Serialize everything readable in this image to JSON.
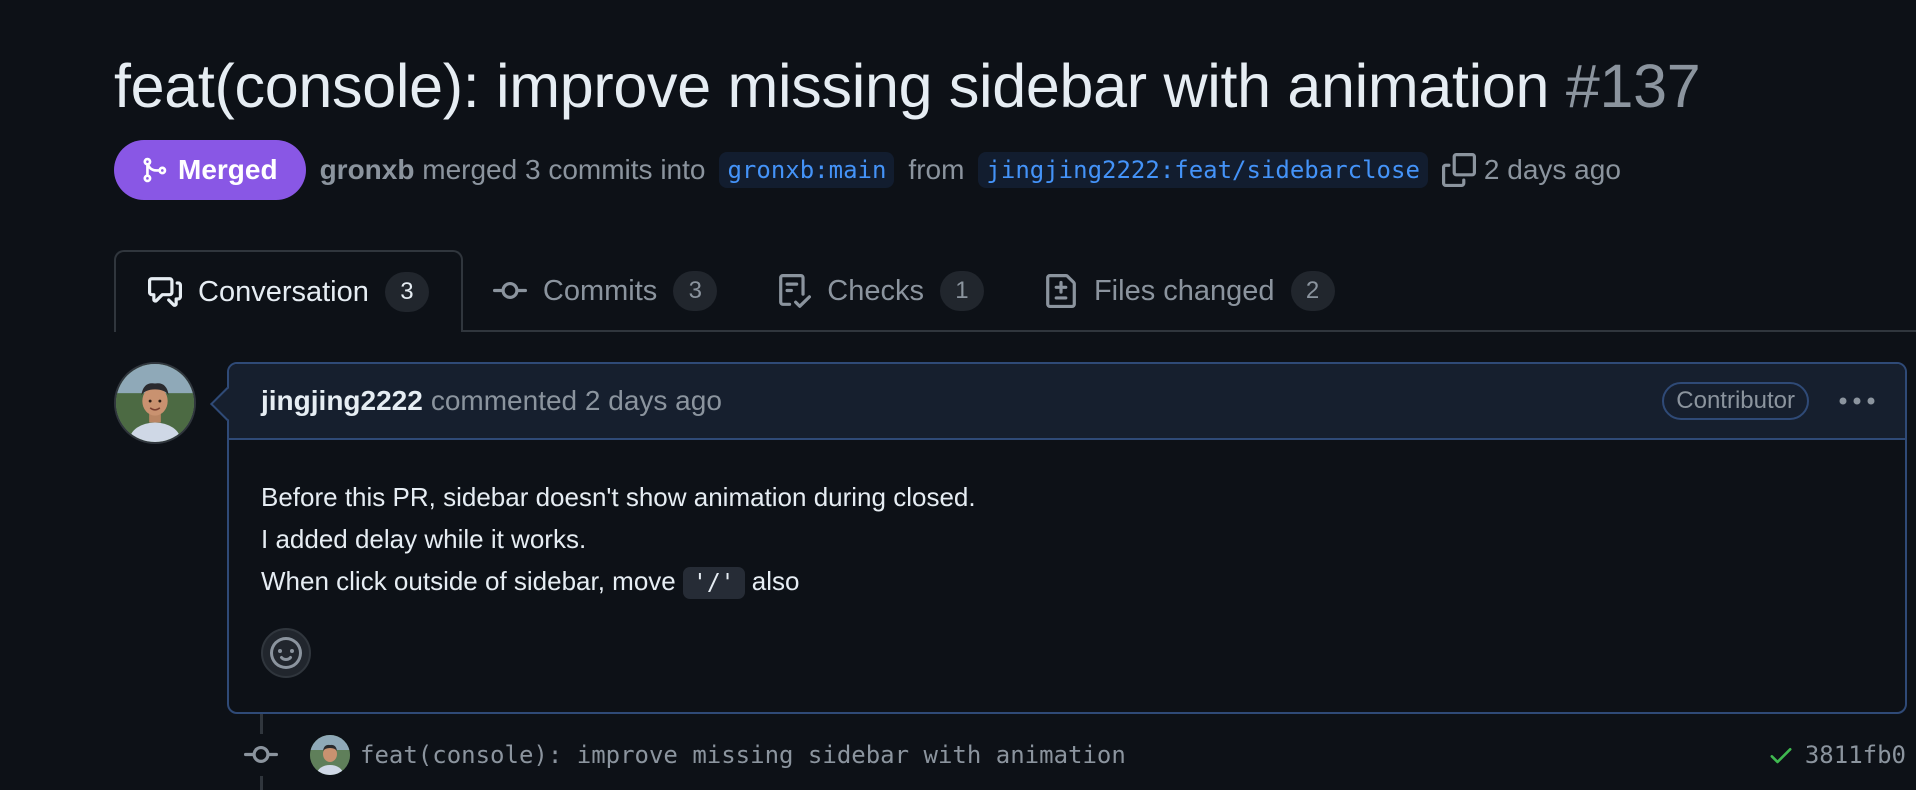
{
  "pr": {
    "title": "feat(console): improve missing sidebar with animation",
    "number": "#137",
    "state_label": "Merged",
    "author": "gronxb",
    "merged_text": "merged 3 commits into",
    "base_branch": "gronxb:main",
    "from_text": "from",
    "head_branch": "jingjing2222:feat/sidebarclose",
    "time": "2 days ago"
  },
  "tabs": [
    {
      "label": "Conversation",
      "count": "3",
      "icon": "comment-discussion-icon",
      "active": true
    },
    {
      "label": "Commits",
      "count": "3",
      "icon": "git-commit-icon",
      "active": false
    },
    {
      "label": "Checks",
      "count": "1",
      "icon": "checklist-icon",
      "active": false
    },
    {
      "label": "Files changed",
      "count": "2",
      "icon": "file-diff-icon",
      "active": false
    }
  ],
  "comment": {
    "author": "jingjing2222",
    "action": "commented 2 days ago",
    "role": "Contributor",
    "lines": [
      "Before this PR, sidebar doesn't show animation during closed.",
      "I added delay while it works."
    ],
    "line3_before": "When click outside of sidebar, move ",
    "line3_code": "'/'",
    "line3_after": " also"
  },
  "commit": {
    "message": "feat(console): improve missing sidebar with animation",
    "sha": "3811fb0",
    "status": "success"
  },
  "colors": {
    "background": "#0d1117",
    "merged": "#8957e5",
    "link": "#4493f8",
    "success": "#3fb950"
  }
}
